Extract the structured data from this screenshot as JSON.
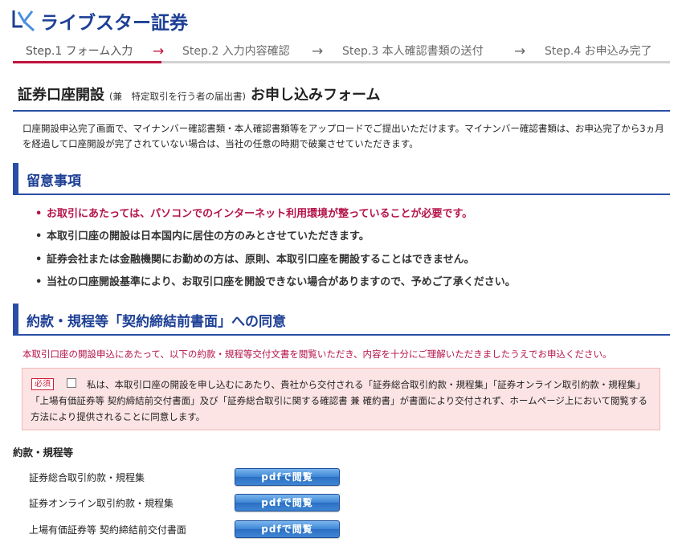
{
  "brand": {
    "name": "ライブスター証券",
    "color": "#1d3f95"
  },
  "steps": [
    {
      "label": "Step.1 フォーム入力",
      "active": true
    },
    {
      "label": "Step.2 入力内容確認",
      "active": false
    },
    {
      "label": "Step.3 本人確認書類の送付",
      "active": false
    },
    {
      "label": "Step.4 お申込み完了",
      "active": false
    }
  ],
  "step_arrow": "→",
  "page_title": {
    "main": "証券口座開設",
    "sub": "(兼　特定取引を行う者の届出書)",
    "tail": "お申し込みフォーム"
  },
  "intro": "口座開設申込完了画面で、マイナンバー確認書類・本人確認書類等をアップロードでご提出いただけます。マイナンバー確認書類は、お申込完了から3ヵ月を経過して口座開設が完了されていない場合は、当社の任意の時期で破棄させていただきます。",
  "notes": {
    "heading": "留意事項",
    "items": [
      "お取引にあたっては、パソコンでのインターネット利用環境が整っていることが必要です。",
      "本取引口座の開設は日本国内に居住の方のみとさせていただきます。",
      "証券会社または金融機関にお勤めの方は、原則、本取引口座を開設することはできません。",
      "当社の口座開設基準により、お取引口座を開設できない場合がありますので、予めご了承ください。"
    ]
  },
  "consent": {
    "heading": "約款・規程等「契約締結前書面」への同意",
    "lead": "本取引口座の開設申込にあたって、以下の約款・規程等交付文書を閲覧いただき、内容を十分にご理解いただきましたうえでお申込ください。",
    "required_badge": "必須",
    "checked": false,
    "text": "私は、本取引口座の開設を申し込むにあたり、貴社から交付される「証券総合取引約款・規程集」「証券オンライン取引約款・規程集」「上場有価証券等 契約締結前交付書面」及び「証券総合取引に関する確認書 兼 確約書」が書面により交付されず、ホームページ上において閲覧する方法により提供されることに同意します。"
  },
  "terms": {
    "title": "約款・規程等",
    "button_label": "pdfで閲覧",
    "documents": [
      "証券総合取引約款・規程集",
      "証券オンライン取引約款・規程集",
      "上場有価証券等 契約締結前交付書面"
    ]
  },
  "colors": {
    "accent_blue": "#2a4ea6",
    "accent_red": "#c0143c",
    "warning_text": "#b5134a",
    "consent_bg": "#fde4e4"
  }
}
